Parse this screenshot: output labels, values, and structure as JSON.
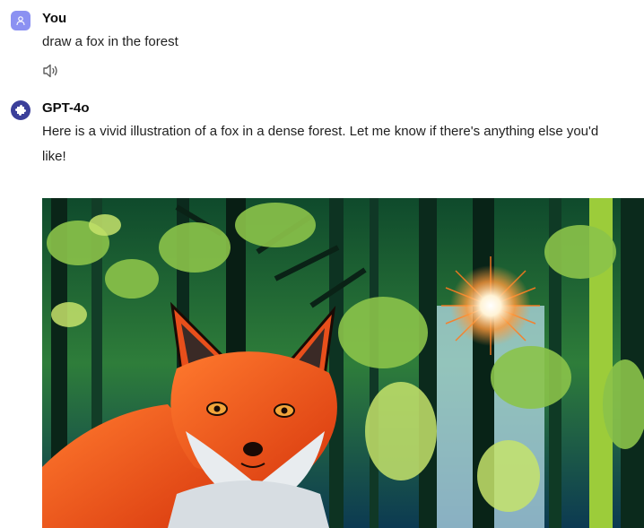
{
  "conversation": {
    "user": {
      "name": "You",
      "message": "draw a fox in the forest",
      "avatar_icon": "user-icon",
      "actions": [
        "speaker-icon"
      ]
    },
    "assistant": {
      "name": "GPT-4o",
      "message_line1": "Here is a vivid illustration of a fox in a dense forest. Let me know if there's anything else you'd",
      "message_line2": "like!",
      "avatar_icon": "puzzle-icon",
      "image": {
        "subject": "fox-in-forest-illustration"
      }
    }
  },
  "colors": {
    "user_avatar": "#8b91f2",
    "assistant_avatar": "#3b3f9a",
    "fox_orange": "#f0571f",
    "forest_green": "#1e6b33",
    "sun_glow": "#ffae5a"
  }
}
